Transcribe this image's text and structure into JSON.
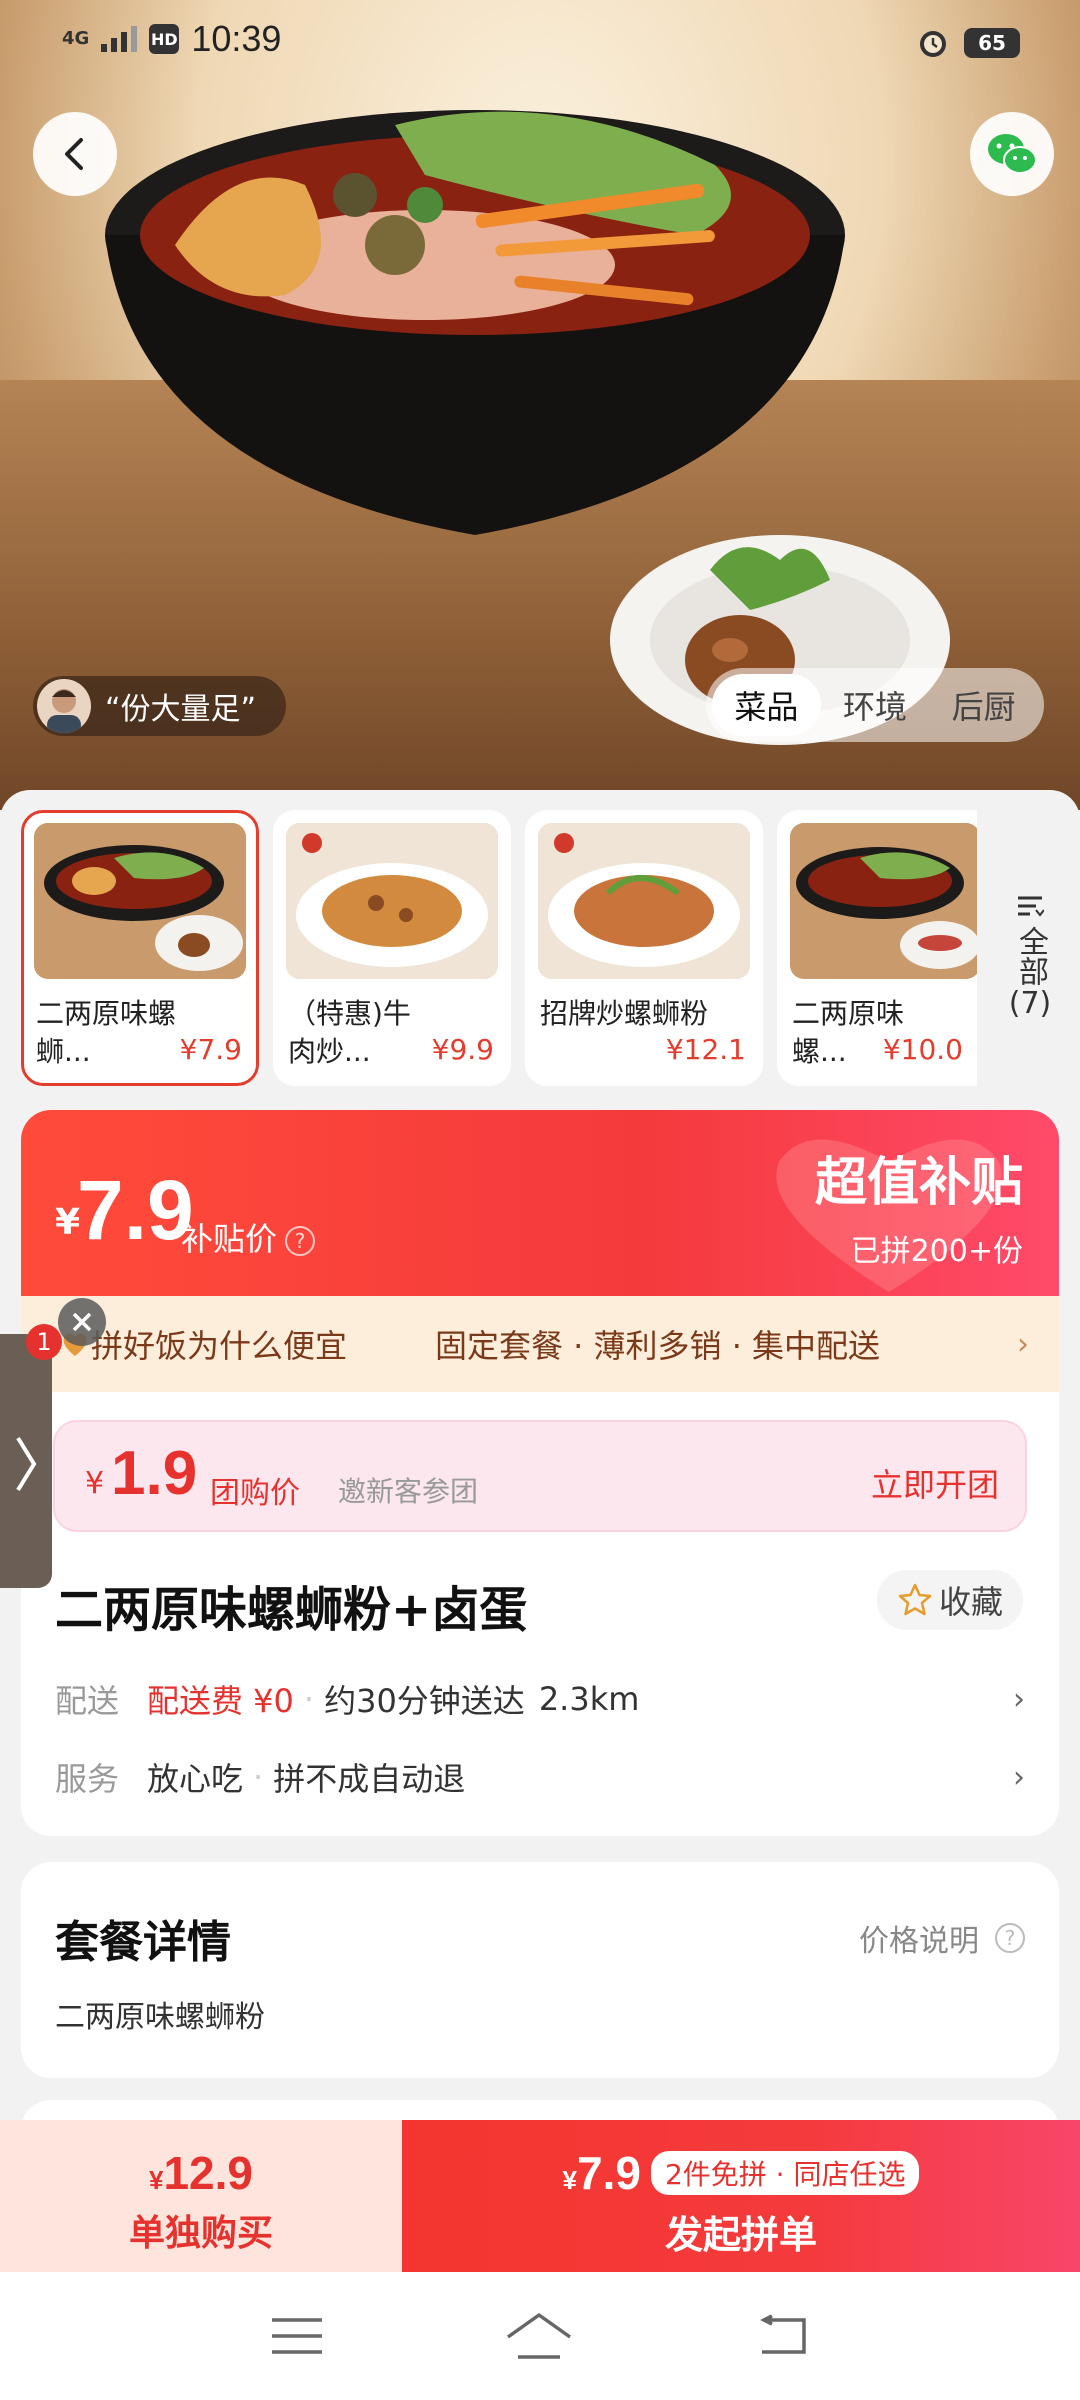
{
  "status_bar": {
    "network": "4G",
    "hd": "HD",
    "time": "10:39",
    "battery": "65"
  },
  "hero": {
    "review_quote": "“份大量足”",
    "tabs": [
      {
        "label": "菜品",
        "active": true
      },
      {
        "label": "环境",
        "active": false
      },
      {
        "label": "后厨",
        "active": false
      }
    ]
  },
  "dishes": [
    {
      "name": "二两原味螺蛳...",
      "price": "¥7.9",
      "selected": true
    },
    {
      "name": "（特惠)牛肉炒...",
      "price": "¥9.9",
      "selected": false
    },
    {
      "name": "招牌炒螺蛳粉",
      "price": "¥12.1",
      "selected": false
    },
    {
      "name": "二两原味螺...",
      "price": "¥10.0",
      "selected": false
    }
  ],
  "all_tab": {
    "label": "全部",
    "count": "(7)"
  },
  "subsidy": {
    "yen": "¥",
    "price": "7.9",
    "label": "补贴价",
    "title": "超值补贴",
    "sold": "已拼200+份"
  },
  "why_bar": {
    "main": "拼好饭为什么便宜",
    "tags": "固定套餐 · 薄利多销 · 集中配送"
  },
  "group_buy": {
    "yen": "¥",
    "price": "1.9",
    "label": "团购价",
    "note": "邀新客参团",
    "action": "立即开团"
  },
  "product": {
    "title": "二两原味螺蛳粉+卤蛋",
    "favorite": "收藏",
    "delivery_key": "配送",
    "delivery_fee": "配送费 ¥0",
    "delivery_time": "约30分钟送达",
    "distance": "2.3km",
    "service_key": "服务",
    "service_1": "放心吃",
    "service_2": "拼不成自动退"
  },
  "details": {
    "title": "套餐详情",
    "price_note": "价格说明",
    "item": "二两原味螺蛳粉"
  },
  "bottom": {
    "solo_yen": "¥",
    "solo_price": "12.9",
    "solo_label": "单独购买",
    "group_yen": "¥",
    "group_price": "7.9",
    "group_chip": "2件免拼 · 同店任选",
    "group_label": "发起拼单"
  },
  "floating": {
    "badge": "1"
  },
  "colors": {
    "accent": "#e6322e",
    "cream": "#fdeedb"
  }
}
